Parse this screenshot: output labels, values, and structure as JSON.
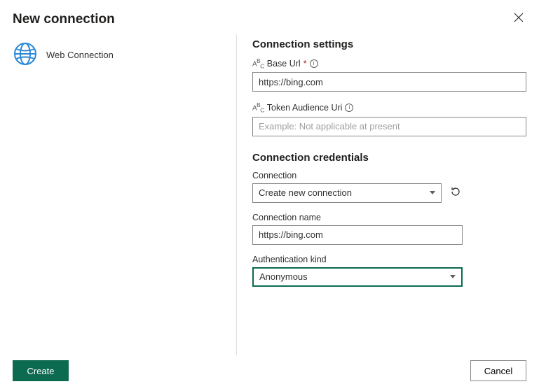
{
  "header": {
    "title": "New connection"
  },
  "sidebar": {
    "web_connection_label": "Web Connection"
  },
  "settings": {
    "title": "Connection settings",
    "base_url": {
      "label": "Base Url",
      "required_marker": "*",
      "value": "https://bing.com"
    },
    "token_audience": {
      "label": "Token Audience Uri",
      "placeholder": "Example: Not applicable at present",
      "value": ""
    }
  },
  "credentials": {
    "title": "Connection credentials",
    "connection": {
      "label": "Connection",
      "selected": "Create new connection"
    },
    "connection_name": {
      "label": "Connection name",
      "value": "https://bing.com"
    },
    "auth_kind": {
      "label": "Authentication kind",
      "selected": "Anonymous"
    }
  },
  "footer": {
    "create": "Create",
    "cancel": "Cancel"
  }
}
